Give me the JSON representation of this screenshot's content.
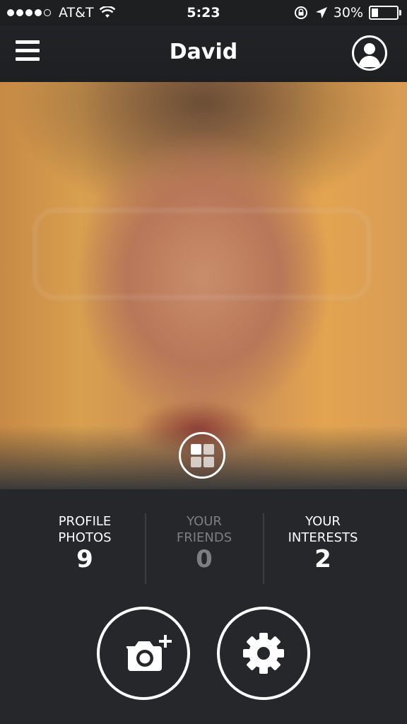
{
  "status_bar": {
    "carrier": "AT&T",
    "time": "5:23",
    "battery_percent": "30%",
    "battery_level": 0.3,
    "icons": [
      "signal-dots-icon",
      "wifi-icon",
      "rotation-lock-icon",
      "location-arrow-icon",
      "battery-icon"
    ]
  },
  "navbar": {
    "title": "David",
    "menu_icon": "hamburger-menu-icon",
    "profile_icon": "user-profile-icon"
  },
  "photo": {
    "overlay_icon": "grid-view-icon"
  },
  "stats": [
    {
      "label_line1": "PROFILE",
      "label_line2": "PHOTOS",
      "count": "9"
    },
    {
      "label_line1": "YOUR",
      "label_line2": "FRIENDS",
      "count": "0"
    },
    {
      "label_line1": "YOUR",
      "label_line2": "INTERESTS",
      "count": "2"
    }
  ],
  "actions": {
    "add_photo_icon": "camera-add-icon",
    "settings_icon": "gear-icon"
  },
  "colors": {
    "background": "#26272a",
    "bar": "#1e1f21",
    "dim_text": "#7d7e82"
  }
}
